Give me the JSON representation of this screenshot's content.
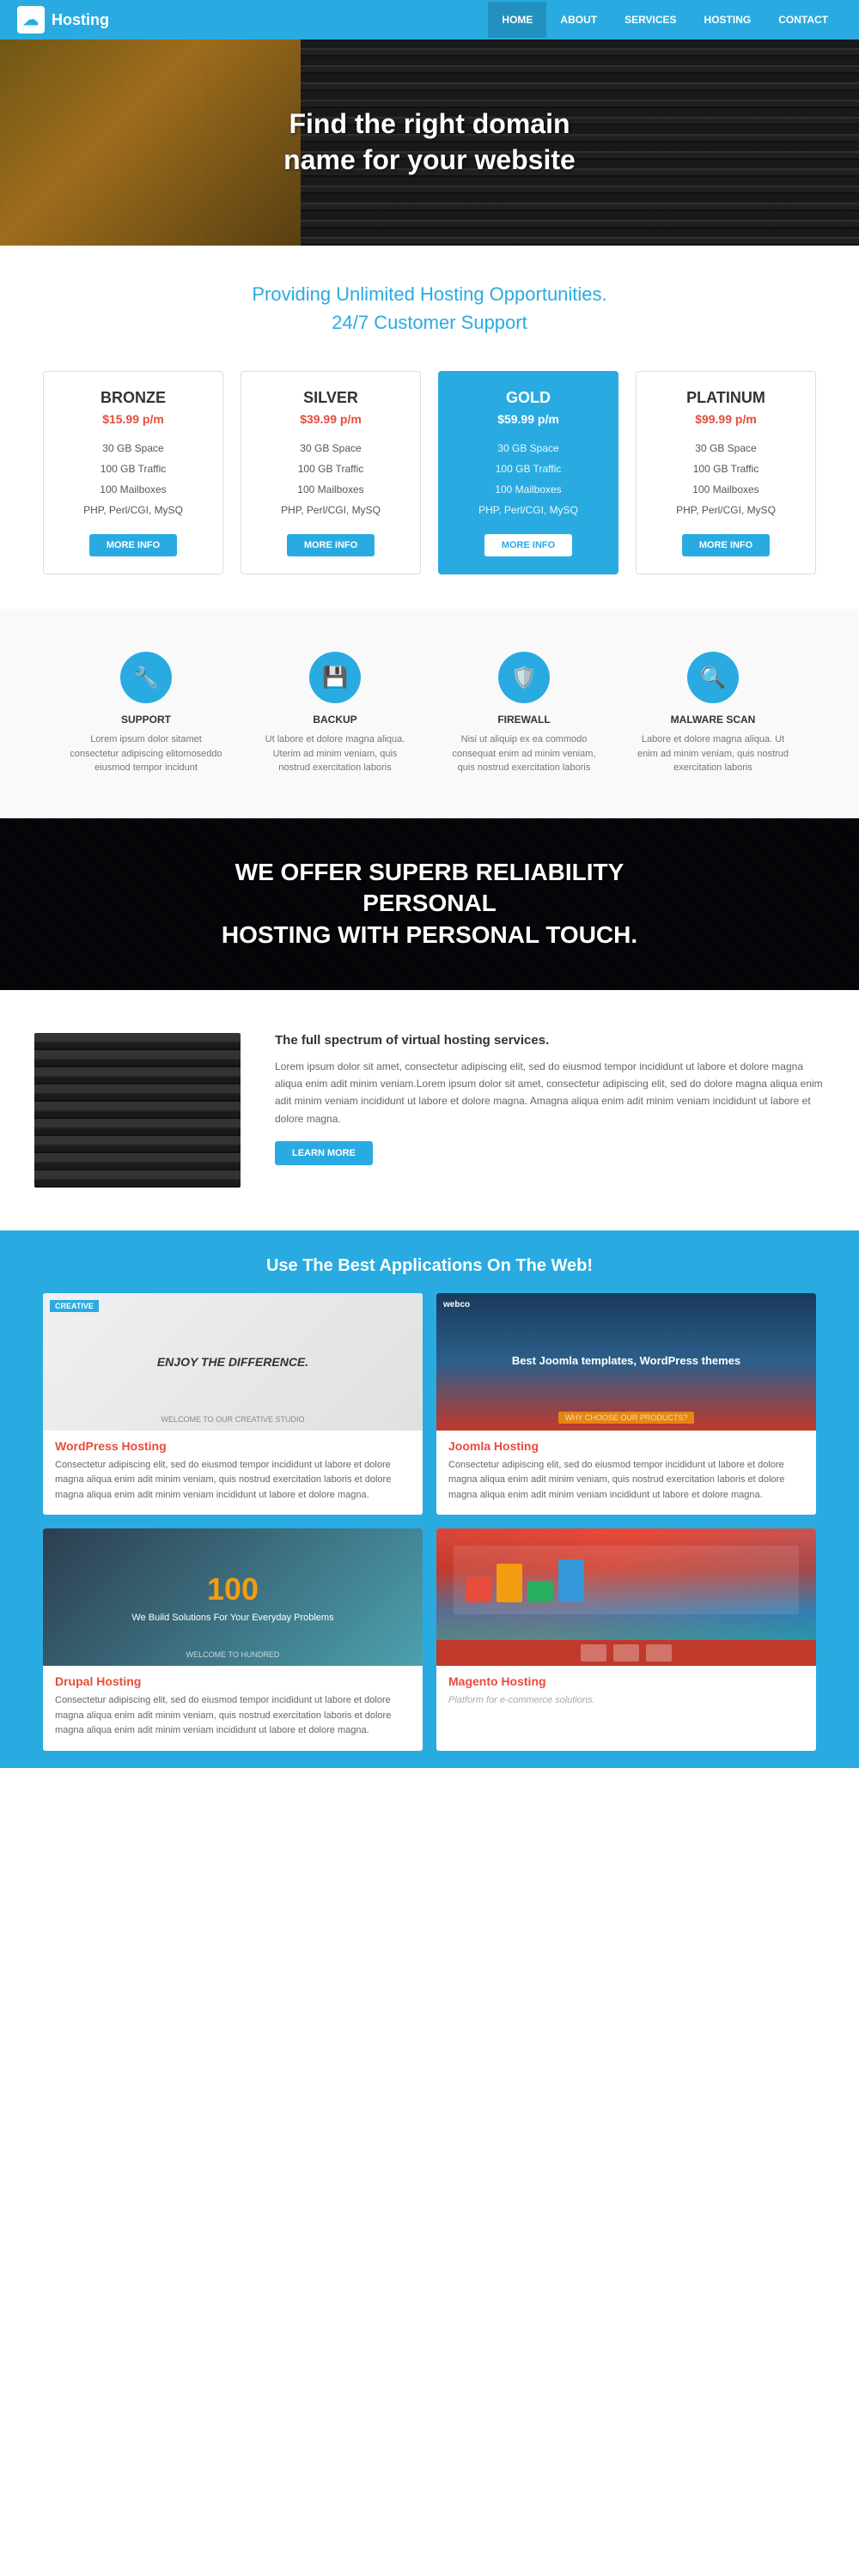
{
  "nav": {
    "logo": "Hosting",
    "links": [
      {
        "label": "HOME",
        "active": true
      },
      {
        "label": "ABOUT"
      },
      {
        "label": "SERVICES"
      },
      {
        "label": "HOSTING"
      },
      {
        "label": "CONTACT"
      }
    ]
  },
  "hero": {
    "line1": "Find the right domain",
    "line2": "name for your website"
  },
  "intro": {
    "line1": "Providing Unlimited Hosting Opportunities.",
    "line2": "24/7 Customer Support"
  },
  "pricing": {
    "cards": [
      {
        "name": "BRONZE",
        "price": "$15.99 p/m",
        "features": [
          "30 GB Space",
          "100 GB Traffic",
          "100 Mailboxes",
          "PHP, Perl/CGI, MySQ"
        ],
        "btn": "MORE INFO",
        "featured": false
      },
      {
        "name": "SILVER",
        "price": "$39.99 p/m",
        "features": [
          "30 GB Space",
          "100 GB Traffic",
          "100 Mailboxes",
          "PHP, Perl/CGI, MySQ"
        ],
        "btn": "MORE INFO",
        "featured": false
      },
      {
        "name": "GOLD",
        "price": "$59.99 p/m",
        "features": [
          "30 GB Space",
          "100 GB Traffic",
          "100 Mailboxes",
          "PHP, Perl/CGI, MySQ"
        ],
        "btn": "MORE INFO",
        "featured": true
      },
      {
        "name": "PLATINUM",
        "price": "$99.99 p/m",
        "features": [
          "30 GB Space",
          "100 GB Traffic",
          "100 Mailboxes",
          "PHP, Perl/CGI, MySQ"
        ],
        "btn": "MORE INFO",
        "featured": false
      }
    ]
  },
  "features": [
    {
      "icon": "🔧",
      "title": "SUPPORT",
      "text": "Lorem ipsum dolor sitamet consectetur adipiscing elitomoseddo eiusmod tempor incidunt"
    },
    {
      "icon": "💾",
      "title": "BACKUP",
      "text": "Ut labore et dolore magna aliqua. Uterim ad minim veniam, quis nostrud exercitation laboris"
    },
    {
      "icon": "🛡️",
      "title": "FIREWALL",
      "text": "Nisi ut aliquip ex ea commodo consequat enim ad minim veniam, quis nostrud exercitation laboris"
    },
    {
      "icon": "🔍",
      "title": "MALWARE SCAN",
      "text": "Labore et dolore magna aliqua. Ut enim ad minim veniam, quis nostrud exercitation laboris"
    }
  ],
  "banner": {
    "line1": "WE OFFER SUPERB RELIABILITY PERSONAL",
    "line2": "HOSTING WITH PERSONAL TOUCH."
  },
  "virtual": {
    "title": "The full spectrum of virtual hosting services.",
    "body": "Lorem ipsum dolor sit amet, consectetur adipiscing elit, sed do eiusmod tempor incididunt ut labore et dolore magna aliqua enim adit minim veniam.Lorem ipsum dolor sit amet, consectetur adipiscing elit, sed do dolore magna aliqua enim adit minim veniam incididunt ut labore et dolore magna. Amagna aliqua enim adit minim veniam incididunt ut labore et dolore magna.",
    "btn": "LEARN MORE"
  },
  "apps": {
    "title": "Use The Best Applications On The Web!",
    "items": [
      {
        "thumb_type": "creative",
        "badge": "CREATIVE",
        "thumb_text": "ENJOY THE DIFFERENCE.",
        "sub": "WELCOME TO OUR CREATIVE STUDIO",
        "title": "WordPress Hosting",
        "desc": "Consectetur adipiscing elit, sed do eiusmod tempor incididunt ut labore et dolore magna aliqua enim adit minim veniam, quis nostrud exercitation laboris et dolore magna aliqua enim adit minim veniam incididunt ut labore et dolore magna."
      },
      {
        "thumb_type": "webco",
        "badge": "webco",
        "thumb_text": "Best Joomla templates, WordPress themes",
        "sub": "WHY CHOOSE OUR PRODUCTS?",
        "title": "Joomla Hosting",
        "desc": "Consectetur adipiscing elit, sed do eiusmod tempor incididunt ut labore et dolore magna aliqua enim adit minim veniam, quis nostrud exercitation laboris et dolore magna aliqua enim adit minim veniam incididunt ut labore et dolore magna."
      },
      {
        "thumb_type": "drupal",
        "badge": "100",
        "thumb_text": "We Build Solutions For Your Everyday Problems",
        "sub": "WELCOME TO HUNDRED",
        "title": "Drupal Hosting",
        "desc": "Consectetur adipiscing elit, sed do eiusmod tempor incididunt ut labore et dolore magna aliqua enim adit minim veniam, quis nostrud exercitation laboris et dolore magna aliqua enim adit minim veniam incididunt ut labore et dolore magna."
      },
      {
        "thumb_type": "magento",
        "badge": "",
        "thumb_text": "",
        "sub": "",
        "title": "Magento Hosting",
        "desc": ""
      }
    ]
  }
}
